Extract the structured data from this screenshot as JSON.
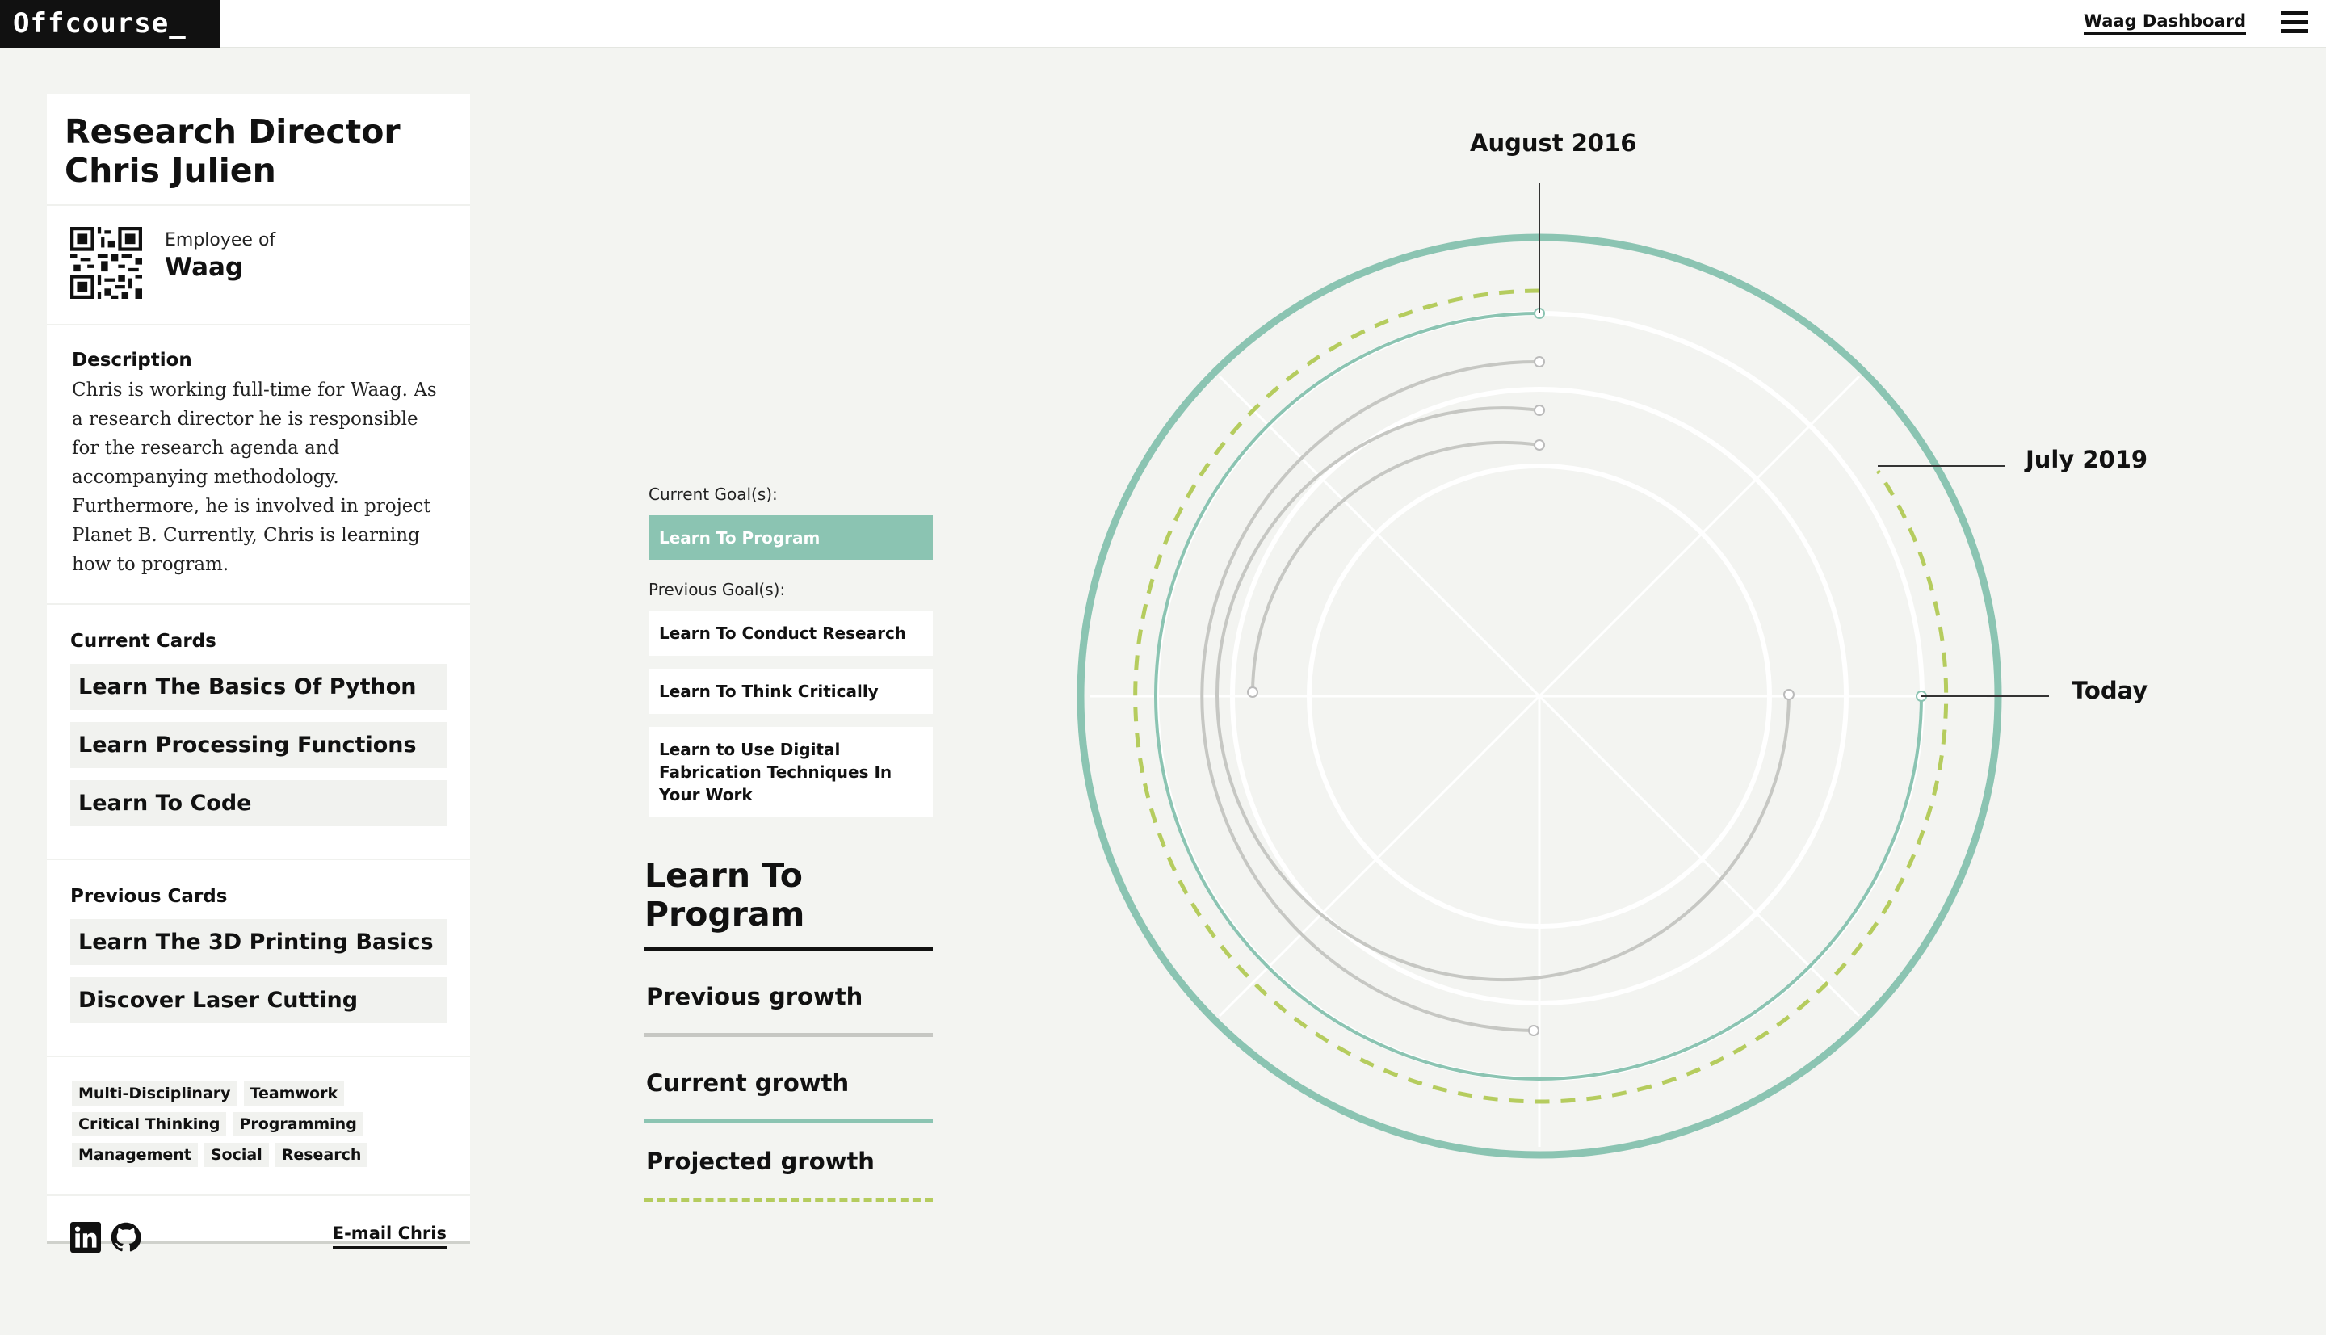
{
  "topbar": {
    "logo": "Offcourse_",
    "dashboard_link": "Waag Dashboard"
  },
  "profile": {
    "title_line1": "Research Director",
    "title_line2": "Chris Julien",
    "employee_of_label": "Employee of",
    "employer": "Waag",
    "description_heading": "Description",
    "description": "Chris is working full-time for Waag. As a research director he is responsible for the research agenda and accompanying methodology. Furthermore, he is involved in project Planet B. Currently, Chris is learning how to program.",
    "current_cards_heading": "Current Cards",
    "current_cards": [
      "Learn The Basics Of Python",
      "Learn Processing Functions",
      "Learn To Code"
    ],
    "previous_cards_heading": "Previous Cards",
    "previous_cards": [
      "Learn The 3D Printing Basics",
      "Discover Laser Cutting"
    ],
    "tags": [
      "Multi-Disciplinary",
      "Teamwork",
      "Critical Thinking",
      "Programming",
      "Management",
      "Social",
      "Research"
    ],
    "email_link": "E-mail Chris"
  },
  "goals": {
    "current_label": "Current Goal(s):",
    "current": [
      "Learn To Program"
    ],
    "previous_label": "Previous Goal(s):",
    "previous": [
      "Learn To Conduct Research",
      "Learn To Think Critically",
      "Learn to Use Digital Fabrication Techniques In Your Work"
    ]
  },
  "legend": {
    "title": "Learn To Program",
    "previous_growth": "Previous growth",
    "current_growth": "Current growth",
    "projected_growth": "Projected growth"
  },
  "chart": {
    "label_start": "August 2016",
    "label_projected": "July 2019",
    "label_today": "Today",
    "colors": {
      "teal": "#8bc4b2",
      "lime": "#b5cc5e",
      "gray": "#c6c7c3",
      "white": "#ffffff"
    }
  }
}
